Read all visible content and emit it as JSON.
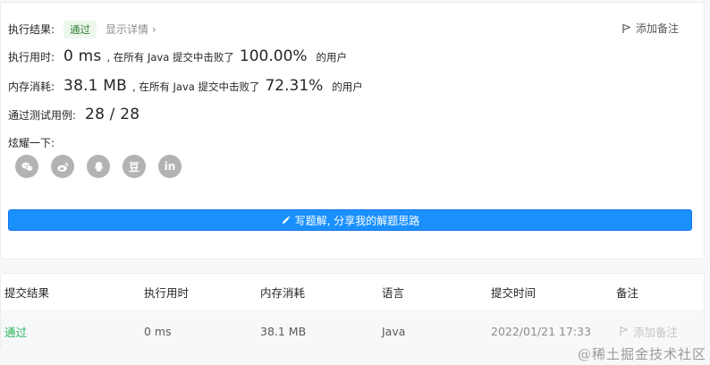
{
  "result": {
    "label": "执行结果:",
    "status": "通过",
    "detail_link": "显示详情 ›",
    "add_note": "添加备注"
  },
  "runtime": {
    "label": "执行用时:",
    "value": "0 ms",
    "prefix": ", 在所有 Java 提交中击败了",
    "percent": "100.00%",
    "suffix": "的用户"
  },
  "memory": {
    "label": "内存消耗:",
    "value": "38.1 MB",
    "prefix": ", 在所有 Java 提交中击败了",
    "percent": "72.31%",
    "suffix": "的用户"
  },
  "testcases": {
    "label": "通过测试用例:",
    "value": "28 / 28"
  },
  "share": {
    "label": "炫耀一下:",
    "items": [
      {
        "icon": "wechat-icon"
      },
      {
        "icon": "weibo-icon"
      },
      {
        "icon": "qq-icon"
      },
      {
        "icon": "douban-icon",
        "text": "豆"
      },
      {
        "icon": "linkedin-icon",
        "text": "in"
      }
    ]
  },
  "solution_button": "写题解, 分享我的解题思路",
  "table": {
    "headers": [
      "提交结果",
      "执行用时",
      "内存消耗",
      "语言",
      "提交时间",
      "备注"
    ],
    "rows": [
      {
        "status": "通过",
        "runtime": "0 ms",
        "memory": "38.1 MB",
        "language": "Java",
        "time": "2022/01/21 17:33",
        "note": "添加备注"
      }
    ]
  },
  "watermark": "@稀土掘金技术社区",
  "colors": {
    "accent": "#1a90ff",
    "success": "#2db55d",
    "share_icon_bg": "#b3b3b3"
  }
}
